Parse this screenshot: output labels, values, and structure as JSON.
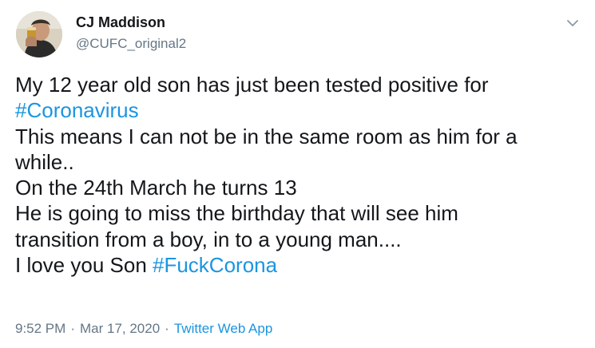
{
  "author": {
    "display_name": "CJ Maddison",
    "handle": "@CUFC_original2",
    "avatar_icon": "user-avatar-photo"
  },
  "menu": {
    "icon": "chevron-down-icon"
  },
  "tweet": {
    "line1": "My 12 year old son has just been tested positive for",
    "hashtag1": "#Coronavirus",
    "line3": "This means I can not be in the same room as him for a",
    "line4": "while..",
    "line5": "On the 24th March he turns 13",
    "line6": "He is going to miss the birthday that will see him",
    "line7": "transition from a boy, in to a young man....",
    "line8_text": "I love you Son ",
    "hashtag2": "#FuckCorona"
  },
  "meta": {
    "time": "9:52 PM",
    "separator1": "·",
    "date": "Mar 17, 2020",
    "separator2": "·",
    "source": "Twitter Web App"
  },
  "colors": {
    "link": "#1b95e0",
    "secondary_text": "#657786",
    "primary_text": "#14171a"
  }
}
